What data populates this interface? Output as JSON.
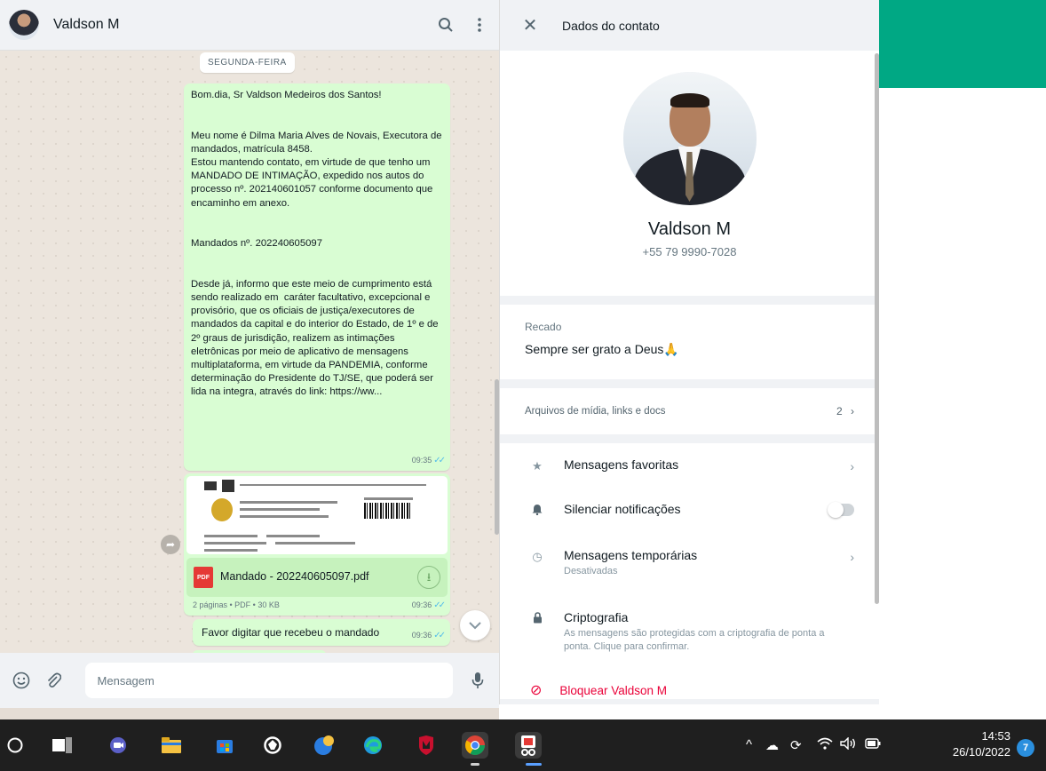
{
  "chat": {
    "contact_name": "Valdson M",
    "day_label": "SEGUNDA-FEIRA",
    "message1": {
      "text": "Bom.dia, Sr Valdson Medeiros dos Santos!\n\n\nMeu nome é Dilma Maria Alves de Novais, Executora de mandados, matrícula 8458.\nEstou mantendo contato, em virtude de que tenho um MANDADO DE INTIMAÇÃO, expedido nos autos do processo nº. 202140601057 conforme documento que encaminho em anexo.\n\n\nMandados nº. 202240605097\n\n\nDesde já, informo que este meio de cumprimento está sendo realizado em  caráter facultativo, excepcional e provisório, que os oficiais de justiça/executores de mandados da capital e do interior do Estado, de 1º e de 2º graus de jurisdição, realizem as intimações eletrônicas por meio de aplicativo de mensagens multiplataforma, em virtude da PANDEMIA, conforme determinação do Presidente do TJ/SE, que poderá ser lida na integra, através do link: https://ww...",
      "time": "09:35"
    },
    "document": {
      "file_name": "Mandado - 202240605097.pdf",
      "icon_label": "PDF",
      "meta": "2 páginas • PDF • 30 KB",
      "time": "09:36"
    },
    "message3": {
      "text": "Favor digitar que recebeu o mandado",
      "time": "09:36"
    },
    "composer_placeholder": "Mensagem",
    "icons": {
      "search": "search-icon",
      "menu": "kebab-menu-icon",
      "emoji": "emoji-icon",
      "attach": "paperclip-icon",
      "mic": "microphone-icon"
    }
  },
  "contact_info": {
    "title": "Dados do contato",
    "name": "Valdson M",
    "phone": "+55 79 9990-7028",
    "about_label": "Recado",
    "about_text": "Sempre ser grato a Deus🙏",
    "media_label": "Arquivos de mídia, links e docs",
    "media_count": "2",
    "actions": {
      "favorites": "Mensagens favoritas",
      "mute": "Silenciar notificações",
      "disappearing": "Mensagens temporárias",
      "disappearing_status": "Desativadas",
      "encryption": "Criptografia",
      "encryption_desc": "As mensagens são protegidas com a criptografia de ponta a ponta. Clique para confirmar."
    },
    "block_label": "Bloquear Valdson M"
  },
  "taskbar": {
    "time": "14:53",
    "date": "26/10/2022",
    "notifications": "7"
  },
  "colors": {
    "accent": "#00a884",
    "bubble_out": "#d9fdd3",
    "danger": "#ea0038"
  }
}
